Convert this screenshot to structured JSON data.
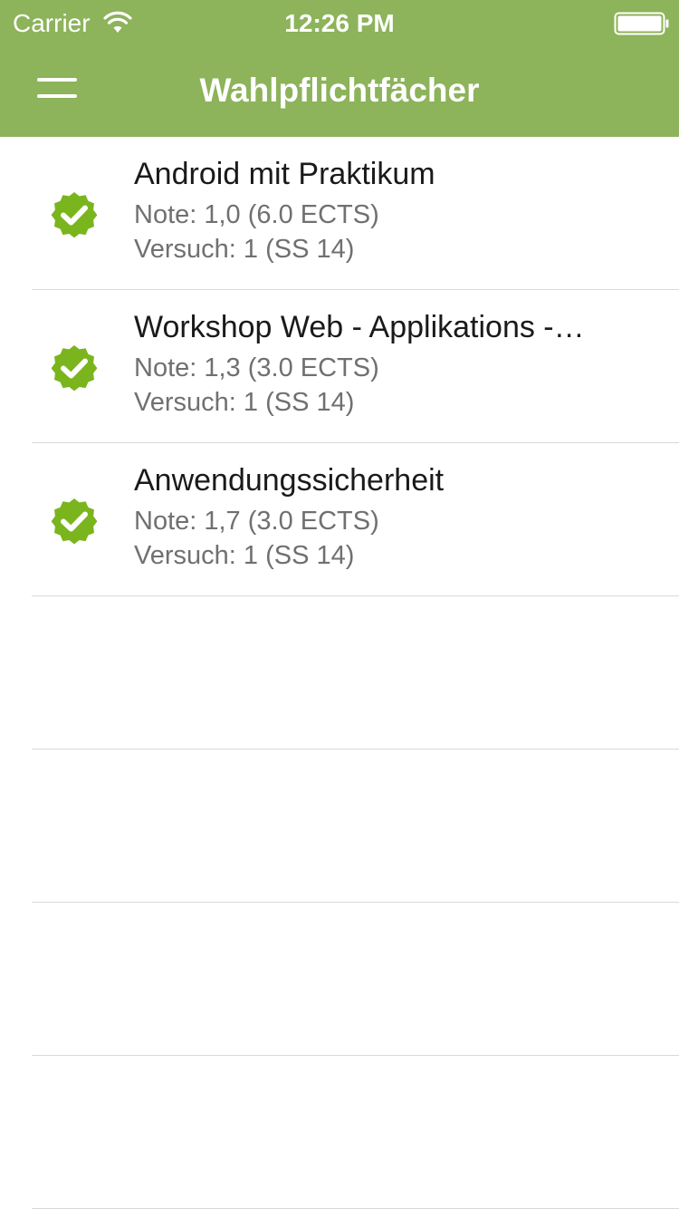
{
  "status_bar": {
    "carrier": "Carrier",
    "time": "12:26 PM",
    "wifi_icon": "wifi-icon",
    "battery_icon": "battery-icon"
  },
  "nav_bar": {
    "title": "Wahlpflichtfächer",
    "menu_icon": "hamburger-menu-icon",
    "background_color": "#8db35b"
  },
  "courses": [
    {
      "title": "Android mit Praktikum",
      "grade": "Note: 1,0 (6.0 ECTS)",
      "attempt": "Versuch: 1 (SS 14)",
      "status_icon": "check-badge-icon"
    },
    {
      "title": "Workshop Web - Applikations -…",
      "grade": "Note: 1,3 (3.0 ECTS)",
      "attempt": "Versuch: 1 (SS 14)",
      "status_icon": "check-badge-icon"
    },
    {
      "title": "Anwendungssicherheit",
      "grade": "Note: 1,7 (3.0 ECTS)",
      "attempt": "Versuch: 1 (SS 14)",
      "status_icon": "check-badge-icon"
    }
  ],
  "colors": {
    "accent": "#8db35b",
    "check_badge": "#7ab51d",
    "subtitle_text": "#707070",
    "separator": "#d9d9d9"
  }
}
